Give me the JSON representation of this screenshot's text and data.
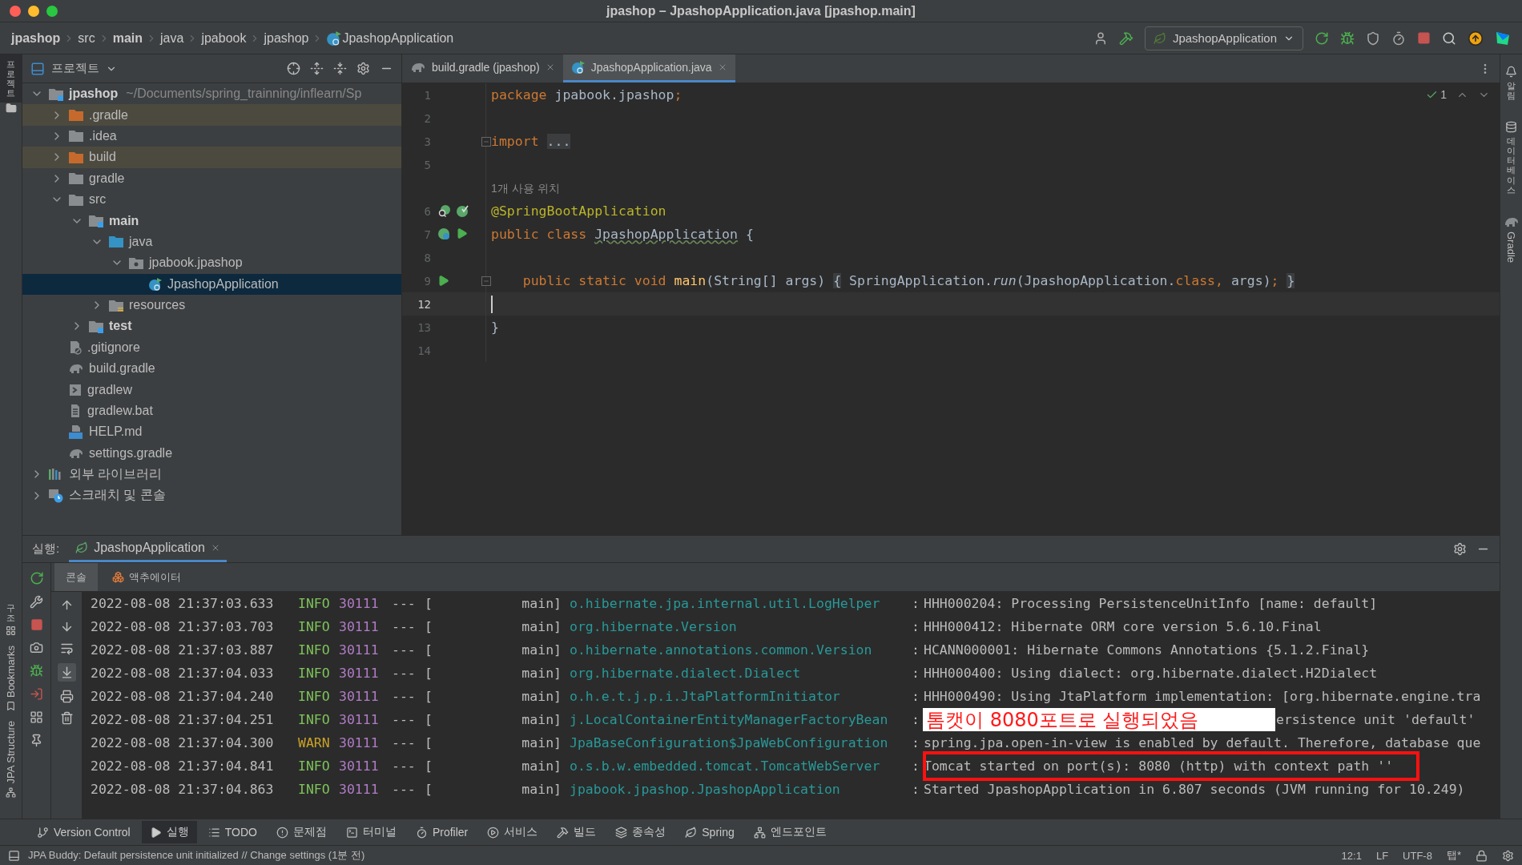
{
  "window": {
    "title": "jpashop – JpashopApplication.java [jpashop.main]"
  },
  "breadcrumbs": [
    {
      "label": "jpashop",
      "bold": true,
      "kind": "plain"
    },
    {
      "label": "src",
      "bold": false,
      "kind": "plain"
    },
    {
      "label": "main",
      "bold": true,
      "kind": "plain"
    },
    {
      "label": "java",
      "bold": false,
      "kind": "plain"
    },
    {
      "label": "jpabook",
      "bold": false,
      "kind": "plain"
    },
    {
      "label": "jpashop",
      "bold": false,
      "kind": "plain"
    },
    {
      "label": "JpashopApplication",
      "bold": false,
      "kind": "class"
    }
  ],
  "run_config": {
    "label": "JpashopApplication"
  },
  "left_strip": {
    "top": [
      {
        "label": "프로젝트",
        "selected": true
      }
    ],
    "bottom": [
      {
        "label": "구조",
        "kind": "cjk"
      },
      {
        "label": "Bookmarks",
        "kind": "latin"
      },
      {
        "label": "JPA Structure",
        "kind": "latin"
      }
    ]
  },
  "right_strip": [
    {
      "label": "알림",
      "kind": "cjk"
    },
    {
      "label": "데이터베이스",
      "kind": "cjk"
    },
    {
      "label": "Gradle",
      "kind": "latin"
    }
  ],
  "project": {
    "title": "프로젝트",
    "tree": [
      {
        "label": "jpashop",
        "path": "~/Documents/spring_trainning/inflearn/Sp",
        "kind": "module",
        "expanded": true,
        "selected": false,
        "excluded": false,
        "children": [
          {
            "label": ".gradle",
            "kind": "folder",
            "expanded": false,
            "selected": false,
            "excluded": true
          },
          {
            "label": ".idea",
            "kind": "folder",
            "expanded": false,
            "selected": false,
            "excluded": false
          },
          {
            "label": "build",
            "kind": "folder",
            "expanded": false,
            "selected": false,
            "excluded": true
          },
          {
            "label": "gradle",
            "kind": "folder",
            "expanded": false,
            "selected": false,
            "excluded": false
          },
          {
            "label": "src",
            "kind": "folder",
            "expanded": true,
            "selected": false,
            "excluded": false,
            "children": [
              {
                "label": "main",
                "kind": "module",
                "expanded": true,
                "selected": false,
                "excluded": false,
                "children": [
                  {
                    "label": "java",
                    "kind": "source",
                    "expanded": true,
                    "selected": false,
                    "excluded": false,
                    "children": [
                      {
                        "label": "jpabook.jpashop",
                        "kind": "package",
                        "expanded": true,
                        "selected": false,
                        "excluded": false,
                        "children": [
                          {
                            "label": "JpashopApplication",
                            "kind": "class",
                            "selected": true,
                            "excluded": false
                          }
                        ]
                      }
                    ]
                  },
                  {
                    "label": "resources",
                    "kind": "resources",
                    "expanded": false,
                    "selected": false,
                    "excluded": false
                  }
                ]
              },
              {
                "label": "test",
                "kind": "module",
                "expanded": false,
                "selected": false,
                "excluded": false
              }
            ]
          },
          {
            "label": ".gitignore",
            "kind": "ignore",
            "selected": false,
            "excluded": false
          },
          {
            "label": "build.gradle",
            "kind": "gradle",
            "selected": false,
            "excluded": false
          },
          {
            "label": "gradlew",
            "kind": "script",
            "selected": false,
            "excluded": false
          },
          {
            "label": "gradlew.bat",
            "kind": "text",
            "selected": false,
            "excluded": false
          },
          {
            "label": "HELP.md",
            "kind": "markdown",
            "selected": false,
            "excluded": false
          },
          {
            "label": "settings.gradle",
            "kind": "gradle",
            "selected": false,
            "excluded": false
          }
        ]
      },
      {
        "label": "외부 라이브러리",
        "kind": "library",
        "expanded": false,
        "selected": false,
        "excluded": false
      },
      {
        "label": "스크래치 및 콘솔",
        "kind": "scratch",
        "expanded": false,
        "selected": false,
        "excluded": false
      }
    ]
  },
  "editor": {
    "tabs": [
      {
        "label": "build.gradle (jpashop)",
        "kind": "gradle",
        "selected": false
      },
      {
        "label": "JpashopApplication.java",
        "kind": "class",
        "selected": true
      }
    ],
    "inspection": "1",
    "lines": [
      {
        "number": "1",
        "kind": "code",
        "current": false,
        "tokens": [
          {
            "t": "package ",
            "kind": "kw"
          },
          {
            "t": "jpabook.jpashop",
            "kind": "plain"
          },
          {
            "t": ";",
            "kind": "kw"
          }
        ]
      },
      {
        "number": "2",
        "kind": "code",
        "current": false
      },
      {
        "number": "3",
        "kind": "code",
        "current": false,
        "fold": true,
        "tokens": [
          {
            "t": "import ",
            "kind": "kw"
          },
          {
            "t": "...",
            "kind": "box"
          }
        ]
      },
      {
        "number": "5",
        "kind": "code",
        "current": false
      },
      {
        "kind": "hint",
        "text": "1개 사용 위치"
      },
      {
        "number": "6",
        "kind": "code",
        "current": false,
        "gutter": [
          {
            "kind": "bean_search"
          },
          {
            "kind": "bean_check"
          }
        ],
        "tokens": [
          {
            "t": "@SpringBootApplication",
            "kind": "ann"
          }
        ]
      },
      {
        "number": "7",
        "kind": "code",
        "current": false,
        "gutter": [
          {
            "kind": "bean_class"
          },
          {
            "kind": "run"
          }
        ],
        "tokens": [
          {
            "t": "public class ",
            "kind": "kw"
          },
          {
            "t": "JpashopApplication",
            "kind": "wavy"
          },
          {
            "t": " {",
            "kind": "plain"
          }
        ]
      },
      {
        "number": "8",
        "kind": "code",
        "current": false
      },
      {
        "number": "9",
        "kind": "code",
        "current": false,
        "fold": true,
        "gutter": [
          {
            "kind": "run"
          }
        ],
        "tokens": [
          {
            "t": "    public static void ",
            "kind": "kw"
          },
          {
            "t": "main",
            "kind": "fn"
          },
          {
            "t": "(String[] args) ",
            "kind": "plain"
          },
          {
            "t": "{",
            "kind": "box"
          },
          {
            "t": " SpringApplication.",
            "kind": "plain"
          },
          {
            "t": "run",
            "kind": "italic"
          },
          {
            "t": "(JpashopApplication.",
            "kind": "plain"
          },
          {
            "t": "class",
            "kind": "kw"
          },
          {
            "t": ", ",
            "kind": "kw"
          },
          {
            "t": "args)",
            "kind": "plain"
          },
          {
            "t": "; ",
            "kind": "kw"
          },
          {
            "t": "}",
            "kind": "box"
          }
        ]
      },
      {
        "number": "12",
        "kind": "code",
        "current": true
      },
      {
        "number": "13",
        "kind": "code",
        "current": false,
        "tokens": [
          {
            "t": "}",
            "kind": "plain"
          }
        ]
      },
      {
        "number": "14",
        "kind": "code",
        "current": false
      }
    ]
  },
  "run": {
    "label": "실행:",
    "tab": "JpashopApplication",
    "subtabs": [
      {
        "label": "콘솔",
        "kind": "console",
        "selected": true
      },
      {
        "label": "액추에이터",
        "kind": "actuator",
        "selected": false
      }
    ],
    "log": [
      {
        "time": "2022-08-08 21:37:03.633",
        "level": "INFO",
        "color": "#7ec35a",
        "pid": "30111",
        "sep": "---",
        "open": "[",
        "thread": "main]",
        "logger": "o.hibernate.jpa.internal.util.LogHelper",
        "colon": ":",
        "message": "HHH000204: Processing PersistenceUnitInfo [name: default]",
        "kind": "plain"
      },
      {
        "time": "2022-08-08 21:37:03.703",
        "level": "INFO",
        "color": "#7ec35a",
        "pid": "30111",
        "sep": "---",
        "open": "[",
        "thread": "main]",
        "logger": "org.hibernate.Version",
        "colon": ":",
        "message": "HHH000412: Hibernate ORM core version 5.6.10.Final",
        "kind": "plain"
      },
      {
        "time": "2022-08-08 21:37:03.887",
        "level": "INFO",
        "color": "#7ec35a",
        "pid": "30111",
        "sep": "---",
        "open": "[",
        "thread": "main]",
        "logger": "o.hibernate.annotations.common.Version",
        "colon": ":",
        "message": "HCANN000001: Hibernate Commons Annotations {5.1.2.Final}",
        "kind": "plain"
      },
      {
        "time": "2022-08-08 21:37:04.033",
        "level": "INFO",
        "color": "#7ec35a",
        "pid": "30111",
        "sep": "---",
        "open": "[",
        "thread": "main]",
        "logger": "org.hibernate.dialect.Dialect",
        "colon": ":",
        "message": "HHH000400: Using dialect: org.hibernate.dialect.H2Dialect",
        "kind": "plain"
      },
      {
        "time": "2022-08-08 21:37:04.240",
        "level": "INFO",
        "color": "#7ec35a",
        "pid": "30111",
        "sep": "---",
        "open": "[",
        "thread": "main]",
        "logger": "o.h.e.t.j.p.i.JtaPlatformInitiator",
        "colon": ":",
        "message": "HHH000490: Using JtaPlatform implementation: [org.hibernate.engine.tra",
        "kind": "plain"
      },
      {
        "time": "2022-08-08 21:37:04.251",
        "level": "INFO",
        "color": "#7ec35a",
        "pid": "30111",
        "sep": "---",
        "open": "[",
        "thread": "main]",
        "logger": "j.LocalContainerEntityManagerFactoryBean",
        "colon": ":",
        "message": "ersistence unit 'default'",
        "kind": "covered"
      },
      {
        "time": "2022-08-08 21:37:04.300",
        "level": "WARN",
        "color": "#c9a227",
        "pid": "30111",
        "sep": "---",
        "open": "[",
        "thread": "main]",
        "logger": "JpaBaseConfiguration$JpaWebConfiguration",
        "colon": ":",
        "message": "spring.jpa.open-in-view is enabled by default. Therefore, database que",
        "kind": "plain"
      },
      {
        "time": "2022-08-08 21:37:04.841",
        "level": "INFO",
        "color": "#7ec35a",
        "pid": "30111",
        "sep": "---",
        "open": "[",
        "thread": "main]",
        "logger": "o.s.b.w.embedded.tomcat.TomcatWebServer",
        "colon": ":",
        "message": "Tomcat started on port(s): 8080 (http) with context path ''",
        "kind": "plain"
      },
      {
        "time": "2022-08-08 21:37:04.863",
        "level": "INFO",
        "color": "#7ec35a",
        "pid": "30111",
        "sep": "---",
        "open": "[",
        "thread": "main]",
        "logger": "jpabook.jpashop.JpashopApplication",
        "colon": ":",
        "message": "Started JpashopApplication in 6.807 seconds (JVM running for 10.249)",
        "kind": "plain"
      }
    ],
    "annotation": {
      "label": "톰캣이 8080포트로 실행되었음"
    }
  },
  "tool_tabs": [
    {
      "label": "Version Control",
      "kind": "vcs",
      "selected": false
    },
    {
      "label": "실행",
      "kind": "run",
      "selected": true
    },
    {
      "label": "TODO",
      "kind": "todo",
      "selected": false
    },
    {
      "label": "문제점",
      "kind": "problems",
      "selected": false
    },
    {
      "label": "터미널",
      "kind": "terminal",
      "selected": false
    },
    {
      "label": "Profiler",
      "kind": "profiler",
      "selected": false
    },
    {
      "label": "서비스",
      "kind": "services",
      "selected": false
    },
    {
      "label": "빌드",
      "kind": "build",
      "selected": false
    },
    {
      "label": "종속성",
      "kind": "deps",
      "selected": false
    },
    {
      "label": "Spring",
      "kind": "spring",
      "selected": false
    },
    {
      "label": "엔드포인트",
      "kind": "endpoints",
      "selected": false
    }
  ],
  "status_bar": {
    "message": "JPA Buddy: Default persistence unit initialized // Change settings (1분 전)",
    "items": [
      "12:1",
      "LF",
      "UTF-8",
      "탭*"
    ]
  }
}
